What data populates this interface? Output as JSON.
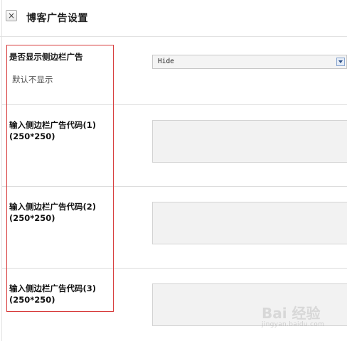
{
  "dialog": {
    "title": "博客广告设置",
    "close_symbol": "×"
  },
  "settings": {
    "show_sidebar_ad": {
      "label": "是否显示侧边栏广告",
      "description": "默认不显示",
      "selected_value": "Hide"
    },
    "ad_codes": [
      {
        "label_line1": "输入侧边栏广告代码(1)",
        "label_line2": "(250*250)",
        "value": ""
      },
      {
        "label_line1": "输入侧边栏广告代码(2)",
        "label_line2": "(250*250)",
        "value": ""
      },
      {
        "label_line1": "输入侧边栏广告代码(3)",
        "label_line2": "(250*250)",
        "value": ""
      }
    ]
  },
  "watermark": {
    "text": "Bai 经验",
    "subtext": "jingyan.baidu.com"
  },
  "colors": {
    "highlight": "#d73a3a",
    "field_bg": "#f2f2f2"
  }
}
